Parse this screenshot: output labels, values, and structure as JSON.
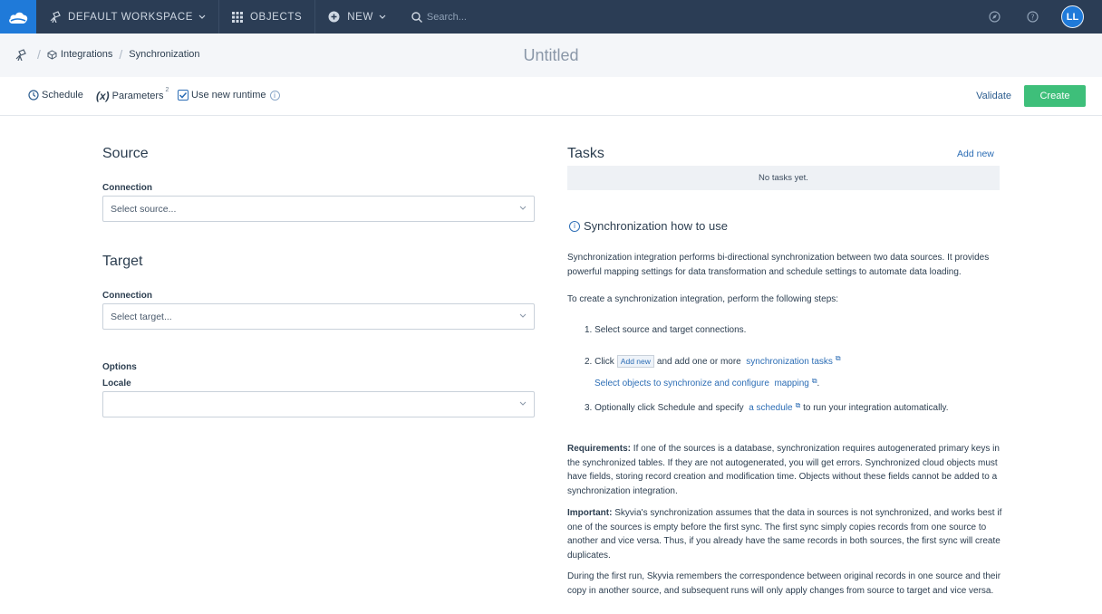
{
  "topnav": {
    "workspace_label": "DEFAULT WORKSPACE",
    "objects_label": "OBJECTS",
    "new_label": "NEW",
    "search_placeholder": "Search...",
    "avatar_initials": "LL"
  },
  "breadcrumb": {
    "integrations": "Integrations",
    "synchronization": "Synchronization"
  },
  "page_title": "Untitled",
  "toolbar": {
    "schedule_label": "Schedule",
    "parameters_prefix": "(x)",
    "parameters_label": "Parameters",
    "parameters_badge": "2",
    "runtime_label": "Use new runtime",
    "info_glyph": "i",
    "validate_label": "Validate",
    "create_label": "Create"
  },
  "source": {
    "title": "Source",
    "connection_label": "Connection",
    "placeholder": "Select source..."
  },
  "target": {
    "title": "Target",
    "connection_label": "Connection",
    "placeholder": "Select target..."
  },
  "options": {
    "title": "Options",
    "locale_label": "Locale",
    "locale_value": ""
  },
  "tasks": {
    "title": "Tasks",
    "add_new": "Add new",
    "empty": "No tasks yet."
  },
  "howto": {
    "title": "Synchronization how to use",
    "info_glyph": "i",
    "intro1": "Synchronization integration performs bi-directional synchronization between two data sources. It provides powerful mapping settings for data transformation and schedule settings to automate data loading.",
    "intro2": "To create a synchronization integration, perform the following steps:",
    "step1": "1. Select source and target connections.",
    "step2_a": "2. Click",
    "step2_btn": "Add new",
    "step2_b": "and add one or more",
    "step2_link": "synchronization tasks",
    "step2_c_link": "Select objects to synchronize and configure",
    "step2_d_link": "mapping",
    "step2_e": ".",
    "step3_a": "3. Optionally click Schedule and specify",
    "step3_link": "a schedule",
    "step3_b": "to run your integration automatically.",
    "ext_glyph": "⧉",
    "req_label": "Requirements:",
    "req_text": " If one of the sources is a database, synchronization requires autogenerated primary keys in the synchronized tables. If they are not autogenerated, you will get errors. Synchronized cloud objects must have fields, storing record creation and modification time. Objects without these fields cannot be added to a synchronization integration.",
    "imp_label": "Important:",
    "imp_text": " Skyvia's synchronization assumes that the data in sources is not synchronized, and works best if one of the sources is empty before the first sync. The first sync simply copies records from one source to another and vice versa. Thus, if you already have the same records in both sources, the first sync will create duplicates.",
    "first_run": "During the first run, Skyvia remembers the correspondence between original records in one source and their copy in another source, and subsequent runs will only apply changes from source to target and vice versa."
  }
}
